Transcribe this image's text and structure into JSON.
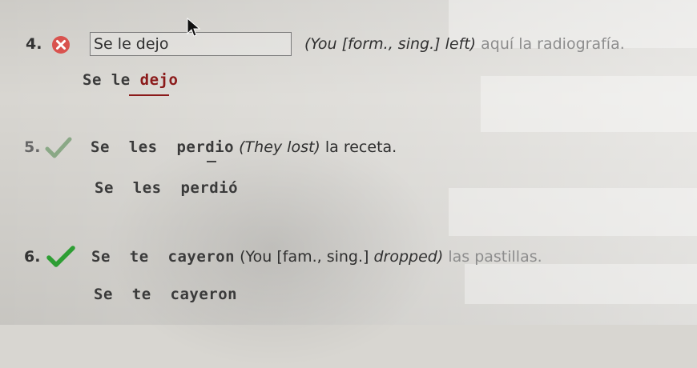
{
  "questions": [
    {
      "number": "4.",
      "status": "incorrect",
      "answer_value": "Se le dejo",
      "hint": "(You [form., sing.] left)",
      "sentence_rest": "aquí la radiografía.",
      "correct_answer_prefix": "Se le ",
      "correct_answer_word": "dejo"
    },
    {
      "number": "5.",
      "status": "correct",
      "answer_text": "Se  les  perdio",
      "hint": "(They lost)",
      "sentence_rest": "la receta.",
      "correct_answer": "Se  les  perdió"
    },
    {
      "number": "6.",
      "status": "correct",
      "answer_text": "Se  te  cayeron",
      "hint_prefix": "(You [fam., sing.]",
      "hint_italic": "dropped)",
      "sentence_rest": "las pastillas.",
      "correct_answer": "Se  te  cayeron"
    }
  ],
  "colors": {
    "correct_green": "#2e9e34",
    "incorrect_red": "#d9534f",
    "correction_red": "#8b1a1a"
  }
}
